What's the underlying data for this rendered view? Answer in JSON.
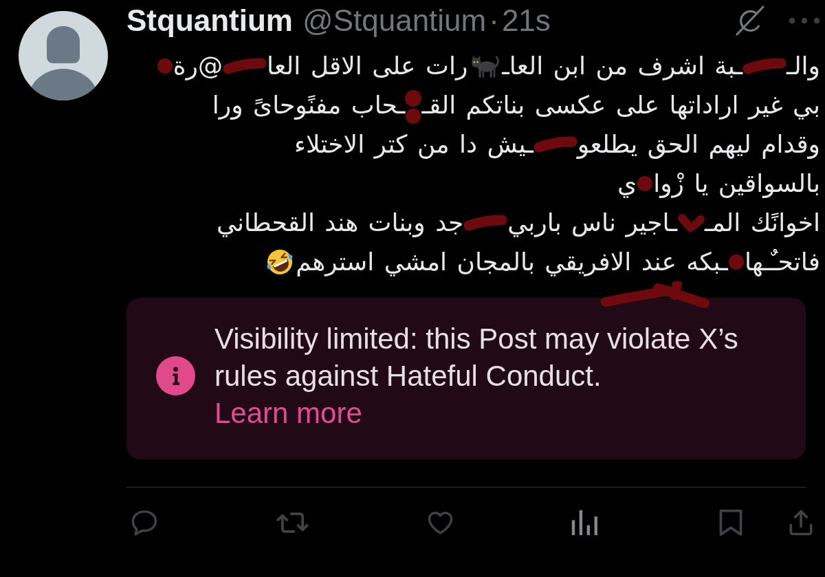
{
  "post": {
    "author": {
      "name": "Stquantium",
      "handle": "@Stquantium",
      "separator": "·",
      "time": "21s"
    },
    "lines": [
      {
        "segments": [
          {
            "kind": "text",
            "text": "والـ"
          },
          {
            "kind": "scribble"
          },
          {
            "kind": "text",
            "text": "ـبة اشرف من ابن العاـ"
          },
          {
            "kind": "cat"
          },
          {
            "kind": "text",
            "text": "رات على الاقل العا"
          },
          {
            "kind": "scribble"
          },
          {
            "kind": "text",
            "text": "@رة"
          },
          {
            "kind": "dot"
          }
        ]
      },
      {
        "segments": [
          {
            "kind": "text",
            "text": "بي غير اراداتها على عكسى بناتكم القـ"
          },
          {
            "kind": "dots"
          },
          {
            "kind": "text",
            "text": "ـحاب مفنًوحاىً ورا"
          }
        ]
      },
      {
        "segments": [
          {
            "kind": "text",
            "text": "وقدام ليهم الحق يطلعو"
          },
          {
            "kind": "scribble"
          },
          {
            "kind": "text",
            "text": "ـيش دا من كتر الاختلاء"
          }
        ]
      },
      {
        "segments": [
          {
            "kind": "text",
            "text": "بالسواقين يا زْوا"
          },
          {
            "kind": "dot"
          },
          {
            "kind": "text",
            "text": "ي"
          }
        ]
      },
      {
        "segments": [
          {
            "kind": "text",
            "text": "اخوانًك المـ"
          },
          {
            "kind": "mark"
          },
          {
            "kind": "text",
            "text": "ـاجير ناس باربي"
          },
          {
            "kind": "scribble"
          },
          {
            "kind": "text",
            "text": "جد وبنات هند القحطاني"
          }
        ]
      },
      {
        "segments": [
          {
            "kind": "text",
            "text": "فاتحـٌـها"
          },
          {
            "kind": "dot"
          },
          {
            "kind": "text",
            "text": "ـبكه عند الافريقي بالمجان امشي استرهم"
          },
          {
            "kind": "laugh"
          }
        ]
      }
    ],
    "notice": {
      "message": "Visibility limited: this Post may violate X’s rules against Hateful Conduct.",
      "link": "Learn more"
    }
  }
}
